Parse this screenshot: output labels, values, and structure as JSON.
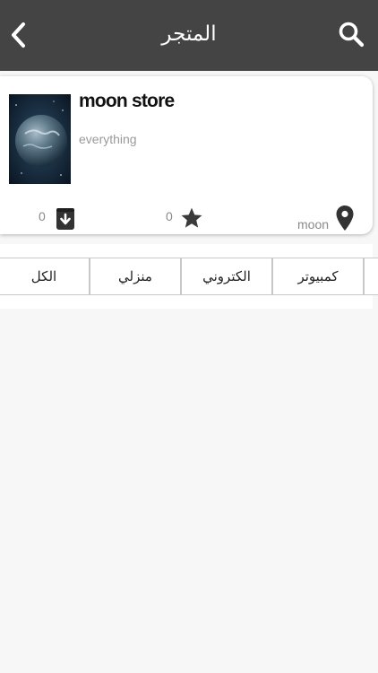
{
  "header": {
    "title": "المتجر",
    "back_icon": "chevron-left-icon",
    "search_icon": "search-icon",
    "background": "#444444"
  },
  "store": {
    "name": "moon store",
    "description": "everything",
    "location": "moon",
    "rating_count": "0",
    "saved_count": "0",
    "image": "earth-from-space-image"
  },
  "categories": {
    "items": [
      "كمبيوتر",
      "الكتروني",
      "منزلي",
      "الكل"
    ]
  }
}
